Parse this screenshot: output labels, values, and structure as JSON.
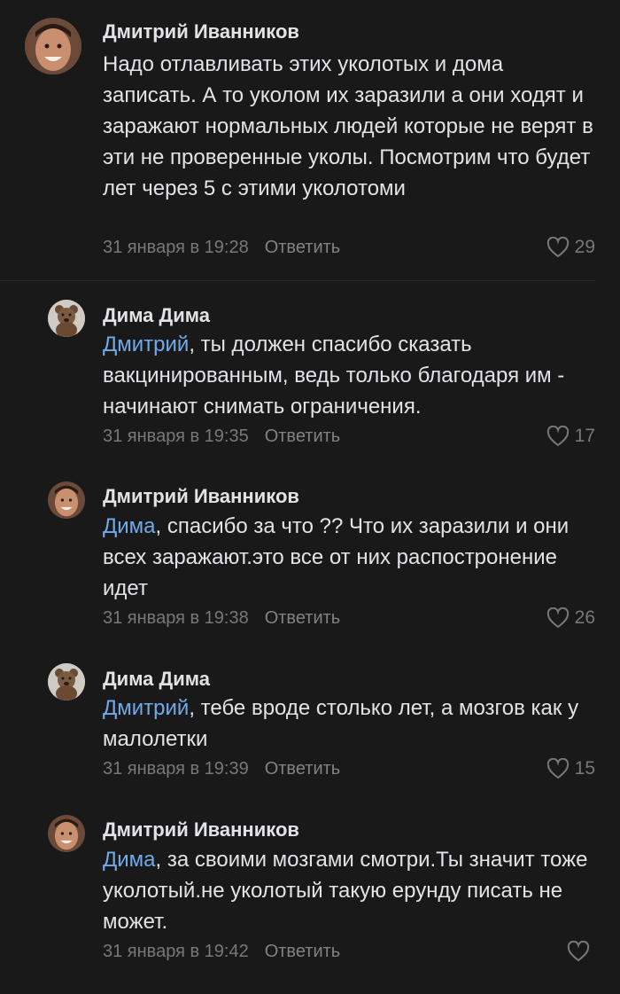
{
  "comments": [
    {
      "author": "Дмитрий Иванников",
      "mention": "",
      "text": "Надо отлавливать этих уколотых и дома записать. А то уколом их заразили а они ходят и заражают нормальных людей которые не верят в эти не проверенные уколы. Посмотрим что будет лет через 5 с этими уколотоми",
      "date": "31 января в 19:28",
      "reply_label": "Ответить",
      "likes": "29",
      "avatar": "face-avatar"
    },
    {
      "author": "Дима Дима",
      "mention": "Дмитрий",
      "text": ", ты должен спасибо сказать вакцинированным, ведь только благодаря им - начинают снимать ограничения.",
      "date": "31 января в 19:35",
      "reply_label": "Ответить",
      "likes": "17",
      "avatar": "teddy-bear-avatar"
    },
    {
      "author": "Дмитрий Иванников",
      "mention": "Дима",
      "text": ", спасибо за что ?? Что их заразили и они всех заражают.это все от них распостронение идет",
      "date": "31 января в 19:38",
      "reply_label": "Ответить",
      "likes": "26",
      "avatar": "face-avatar"
    },
    {
      "author": "Дима Дима",
      "mention": "Дмитрий",
      "text": ", тебе вроде столько лет, а мозгов как у малолетки",
      "date": "31 января в 19:39",
      "reply_label": "Ответить",
      "likes": "15",
      "avatar": "teddy-bear-avatar"
    },
    {
      "author": "Дмитрий Иванников",
      "mention": "Дима",
      "text": ", за своими мозгами смотри.Ты значит тоже уколотый.не уколотый такую ерунду писать не может.",
      "date": "31 января в 19:42",
      "reply_label": "Ответить",
      "likes": "",
      "avatar": "face-avatar"
    }
  ],
  "colors": {
    "background": "#19191a",
    "text": "#e1e3e6",
    "mention": "#71aaeb",
    "meta": "#76787a"
  }
}
